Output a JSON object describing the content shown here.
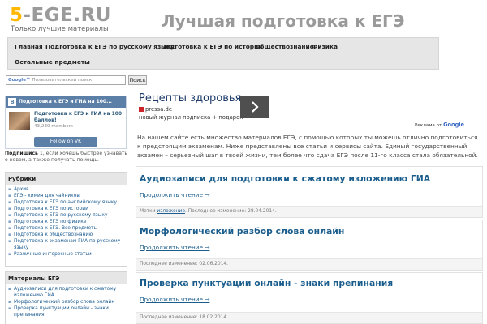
{
  "header": {
    "logo_accent": "5",
    "logo_rest": "-EGE.RU",
    "tagline": "Только лучшие материалы",
    "site_title": "Лучшая подготовка к ЕГЭ"
  },
  "nav": {
    "items": [
      "Главная",
      "Подготовка к ЕГЭ по русскому языку",
      "Подготовка к ЕГЭ по истории",
      "Обществознание",
      "Физика",
      "Остальные предметы"
    ]
  },
  "search": {
    "placeholder_brand": "Google™",
    "placeholder_text": " Пользовательский поиск",
    "button_label": "Поиск"
  },
  "vk": {
    "logo_letter": "B",
    "widget_title": "Подготовка к ЕГЭ и ГИА на 100...",
    "group_name": "Подготовка к ЕГЭ и ГИА на 100 баллов!",
    "members": "43,239 members",
    "follow_label": "Follow on VK"
  },
  "subscribe_note": {
    "bold": "Подпишись",
    "rest": " 1, если хочешь быстрее узнавать о новом, а также получать помощь."
  },
  "rubrics": {
    "title": "Рубрики",
    "items": [
      "Архив",
      "ЕГЭ - химия для чайников",
      "Подготовка к ЕГЭ по английскому языку",
      "Подготовка к ЕГЭ по истории",
      "Подготовка к ЕГЭ по русскому языку",
      "Подготовка к ЕГЭ по физике",
      "Подготовка к ЕГЭ. Все предметы",
      "Подготовка к обществознанию",
      "Подготовка к экзаменам ГИА по русскому языку",
      "Различные интересные статьи"
    ]
  },
  "materials": {
    "title": "Материалы ЕГЭ",
    "items": [
      "Аудиозаписи для подготовки к сжатому изложению ГИА",
      "Морфологический разбор слова онлайн",
      "Проверка пунктуации онлайн - знаки препинания"
    ]
  },
  "ad": {
    "title": "Рецепты здоровья",
    "source": "pressa.de",
    "subtitle": "новый журнал подписка + подарок",
    "by_text": "Реклама от ",
    "by_brand": "Google"
  },
  "intro": "На нашем сайте есть множество материалов ЕГЭ, с помощью которых ты можешь отлично подготовиться к предстоящим экзаменам. Ниже представлены все статьи и сервисы сайта. Единый государственный экзамен – серьезный шаг в твоей жизни, тем более что сдача ЕГЭ после 11-го класса стала обязательной.",
  "posts": [
    {
      "title": "Аудиозаписи для подготовки к сжатому изложению ГИА",
      "read_more": "Продолжить чтение →",
      "meta_prefix": "Метки ",
      "meta_tag": "изложение",
      "meta_rest": ". Последнее изменение: 28.04.2014."
    },
    {
      "title": "Морфологический разбор слова онлайн",
      "read_more": "Продолжить чтение →",
      "meta_rest": "Последнее изменение: 02.06.2014."
    },
    {
      "title": "Проверка пунктуации онлайн - знаки препинания",
      "read_more": "Продолжить чтение →",
      "meta_rest": "Последнее изменение: 18.02.2014."
    }
  ],
  "colors": {
    "logo_accent": "#ffb700",
    "link": "#1a5d8c",
    "vk_blue": "#5b7fa6",
    "nav_bg": "#e6e6e6"
  }
}
